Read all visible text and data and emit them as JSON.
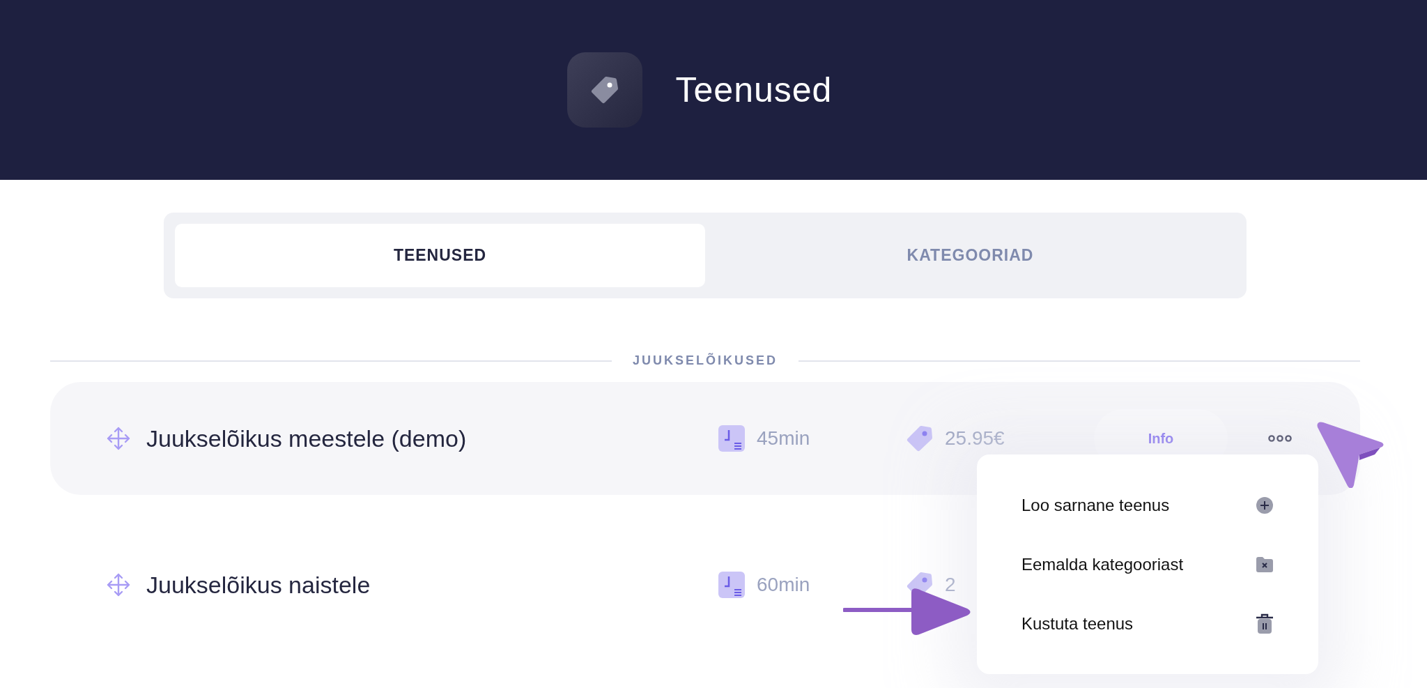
{
  "header": {
    "title": "Teenused"
  },
  "tabs": [
    {
      "label": "TEENUSED",
      "selected": true
    },
    {
      "label": "KATEGOORIAD",
      "selected": false
    }
  ],
  "category": {
    "title": "JUUKSELÕIKUSED"
  },
  "services": [
    {
      "name": "Juukselõikus meestele (demo)",
      "duration": "45min",
      "price": "25.95€",
      "info_button": "Info"
    },
    {
      "name": "Juukselõikus naistele",
      "duration": "60min",
      "price": "2"
    }
  ],
  "context_menu": {
    "items": [
      {
        "label": "Loo sarnane teenus",
        "kind": "add"
      },
      {
        "label": "Eemalda kategooriast",
        "kind": "remove"
      },
      {
        "label": "Kustuta teenus",
        "kind": "delete"
      }
    ]
  }
}
